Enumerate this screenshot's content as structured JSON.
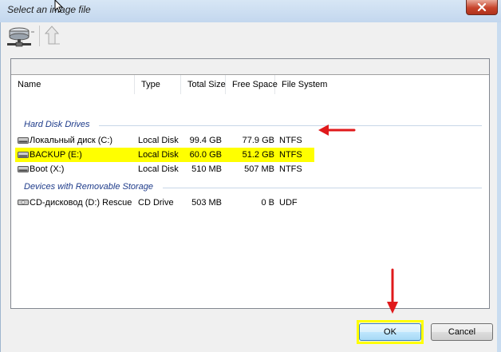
{
  "window": {
    "title": "Select an image file",
    "close_icon": "close-icon"
  },
  "toolbar": {
    "drives_icon": "network-drives-icon",
    "up_icon": "up-folder-icon"
  },
  "path": {
    "value": ""
  },
  "columns": {
    "name": "Name",
    "type": "Type",
    "total_size": "Total Size",
    "free_space": "Free Space",
    "file_system": "File System"
  },
  "groups": [
    {
      "label": "Hard Disk Drives",
      "items": [
        {
          "name": "Локальный диск (C:)",
          "type": "Local Disk",
          "total": "99.4 GB",
          "free": "77.9 GB",
          "fs": "NTFS",
          "highlighted": false
        },
        {
          "name": "BACKUP (E:)",
          "type": "Local Disk",
          "total": "60.0 GB",
          "free": "51.2 GB",
          "fs": "NTFS",
          "highlighted": true
        },
        {
          "name": "Boot (X:)",
          "type": "Local Disk",
          "total": "510 MB",
          "free": "507 MB",
          "fs": "NTFS",
          "highlighted": false
        }
      ]
    },
    {
      "label": "Devices with Removable Storage",
      "items": [
        {
          "name": "CD-дисковод (D:) Rescue",
          "type": "CD Drive",
          "total": "503 MB",
          "free": "0 B",
          "fs": "UDF",
          "highlighted": false
        }
      ]
    }
  ],
  "buttons": {
    "ok": "OK",
    "cancel": "Cancel"
  },
  "colors": {
    "highlight": "#ffff00",
    "annotation_arrow": "#e0191b"
  }
}
